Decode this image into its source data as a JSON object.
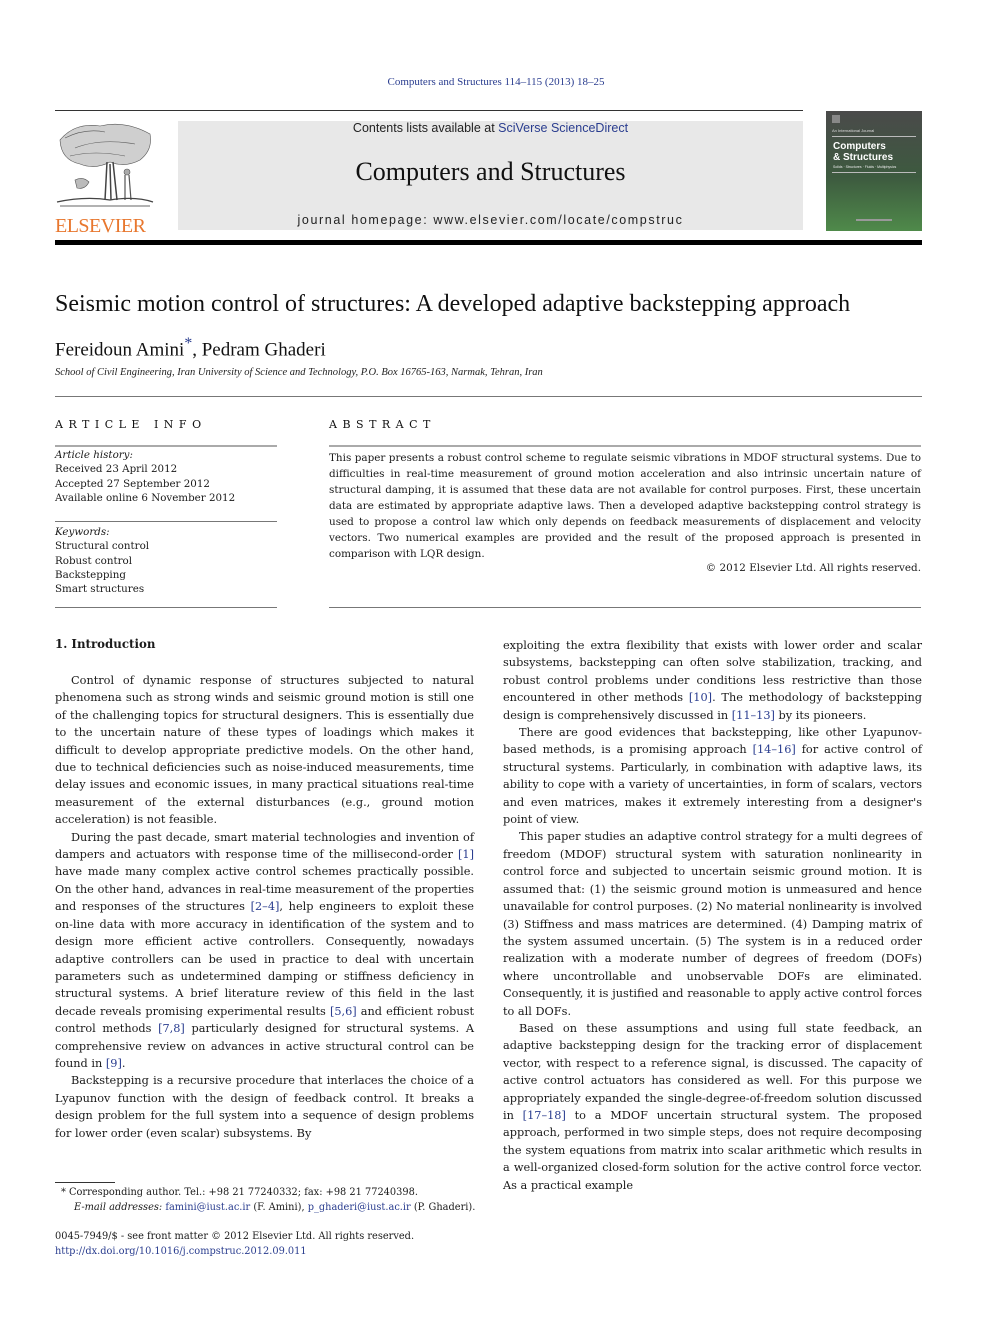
{
  "running_head": "Computers and Structures 114–115 (2013) 18–25",
  "header": {
    "publisher_logo_text": "ELSEVIER",
    "contents_prefix": "Contents lists available at ",
    "contents_link": "SciVerse ScienceDirect",
    "journal_title": "Computers and Structures",
    "homepage": "journal homepage: www.elsevier.com/locate/compstruc",
    "cover": {
      "kicker": "An International Journal",
      "title_line1": "Computers",
      "title_line2": "& Structures",
      "subtitle": "Solids · Structures · Fluids · Multiphysics"
    }
  },
  "article": {
    "title": "Seismic motion control of structures: A developed adaptive backstepping approach",
    "authors": [
      {
        "name": "Fereidoun Amini",
        "mark": "*"
      },
      {
        "name": "Pedram Ghaderi",
        "mark": ""
      }
    ],
    "author_separator": ", ",
    "affiliation": "School of Civil Engineering, Iran University of Science and Technology, P.O. Box 16765-163, Narmak, Tehran, Iran"
  },
  "article_info": {
    "heading": "ARTICLE INFO",
    "history_label": "Article history:",
    "history": [
      "Received 23 April 2012",
      "Accepted 27 September 2012",
      "Available online 6 November 2012"
    ],
    "keywords_label": "Keywords:",
    "keywords": [
      "Structural control",
      "Robust control",
      "Backstepping",
      "Smart structures"
    ]
  },
  "abstract": {
    "heading": "ABSTRACT",
    "text": "This paper presents a robust control scheme to regulate seismic vibrations in MDOF structural systems. Due to difficulties in real-time measurement of ground motion acceleration and also intrinsic uncertain nature of structural damping, it is assumed that these data are not available for control purposes. First, these uncertain data are estimated by appropriate adaptive laws. Then a developed adaptive backstepping control strategy is used to propose a control law which only depends on feedback measurements of displacement and velocity vectors. Two numerical examples are provided and the result of the proposed approach is presented in comparison with LQR design.",
    "copyright": "© 2012 Elsevier Ltd. All rights reserved."
  },
  "body": {
    "section_heading": "1. Introduction",
    "left_paragraphs": [
      [
        {
          "t": "Control of dynamic response of structures subjected to natural phenomena such as strong winds and seismic ground motion is still one of the challenging topics for structural designers. This is essentially due to the uncertain nature of these types of loadings which makes it difficult to develop appropriate predictive models. On the other hand, due to technical deficiencies such as noise-induced measurements, time delay issues and economic issues, in many practical situations real-time measurement of the external disturbances (e.g., ground motion acceleration) is not feasible."
        }
      ],
      [
        {
          "t": "During the past decade, smart material technologies and invention of dampers and actuators with response time of the millisecond-order "
        },
        {
          "ref": "[1]"
        },
        {
          "t": " have made many complex active control schemes practically possible. On the other hand, advances in real-time measurement of the properties and responses of the structures "
        },
        {
          "ref": "[2–4]"
        },
        {
          "t": ", help engineers to exploit these on-line data with more accuracy in identification of the system and to design more efficient active controllers. Consequently, nowadays adaptive controllers can be used in practice to deal with uncertain parameters such as undetermined damping or stiffness deficiency in structural systems. A brief literature review of this field in the last decade reveals promising experimental results "
        },
        {
          "ref": "[5,6]"
        },
        {
          "t": " and efficient robust control methods "
        },
        {
          "ref": "[7,8]"
        },
        {
          "t": " particularly designed for structural systems. A comprehensive review on advances in active structural control can be found in "
        },
        {
          "ref": "[9]"
        },
        {
          "t": "."
        }
      ],
      [
        {
          "t": "Backstepping is a recursive procedure that interlaces the choice of a Lyapunov function with the design of feedback control. It breaks a design problem for the full system into a sequence of design problems for lower order (even scalar) subsystems. By"
        }
      ]
    ],
    "right_paragraphs": [
      [
        {
          "t": "exploiting the extra flexibility that exists with lower order and scalar subsystems, backstepping can often solve stabilization, tracking, and robust control problems under conditions less restrictive than those encountered in other methods "
        },
        {
          "ref": "[10]"
        },
        {
          "t": ". The methodology of backstepping design is comprehensively discussed in "
        },
        {
          "ref": "[11–13]"
        },
        {
          "t": " by its pioneers."
        }
      ],
      [
        {
          "t": "There are good evidences that backstepping, like other Lyapunov-based methods, is a promising approach "
        },
        {
          "ref": "[14–16]"
        },
        {
          "t": " for active control of structural systems. Particularly, in combination with adaptive laws, its ability to cope with a variety of uncertainties, in form of scalars, vectors and even matrices, makes it extremely interesting from a designer's point of view."
        }
      ],
      [
        {
          "t": "This paper studies an adaptive control strategy for a multi degrees of freedom (MDOF) structural system with saturation nonlinearity in control force and subjected to uncertain seismic ground motion. It is assumed that: (1) the seismic ground motion is unmeasured and hence unavailable for control purposes. (2) No material nonlinearity is involved (3) Stiffness and mass matrices are determined. (4) Damping matrix of the system assumed uncertain. (5) The system is in a reduced order realization with a moderate number of degrees of freedom (DOFs) where uncontrollable and unobservable DOFs are eliminated. Consequently, it is justified and reasonable to apply active control forces to all DOFs."
        }
      ],
      [
        {
          "t": "Based on these assumptions and using full state feedback, an adaptive backstepping design for the tracking error of displacement vector, with respect to a reference signal, is discussed. The capacity of active control actuators has considered as well. For this purpose we appropriately expanded the single-degree-of-freedom solution discussed in "
        },
        {
          "ref": "[17–18]"
        },
        {
          "t": " to a MDOF uncertain structural system. The proposed approach, performed in two simple steps, does not require decomposing the system equations from matrix into scalar arithmetic which results in a well-organized closed-form solution for the active control force vector. As a practical example"
        }
      ]
    ]
  },
  "footnote": {
    "mark": "*",
    "corresponding": " Corresponding author. Tel.: +98 21 77240332; fax: +98 21 77240398.",
    "email_label": "E-mail addresses:",
    "email1": "famini@iust.ac.ir",
    "email1_owner": " (F. Amini), ",
    "email2": "p_ghaderi@iust.ac.ir",
    "email2_owner": " (P. Ghaderi)."
  },
  "front_matter": {
    "issn_line": "0045-7949/$ - see front matter © 2012 Elsevier Ltd. All rights reserved.",
    "doi": "http://dx.doi.org/10.1016/j.compstruc.2012.09.011"
  },
  "colors": {
    "link": "#2a3d8f",
    "elsevier_orange": "#e8772e",
    "banner_bg": "#e8e8e8"
  }
}
